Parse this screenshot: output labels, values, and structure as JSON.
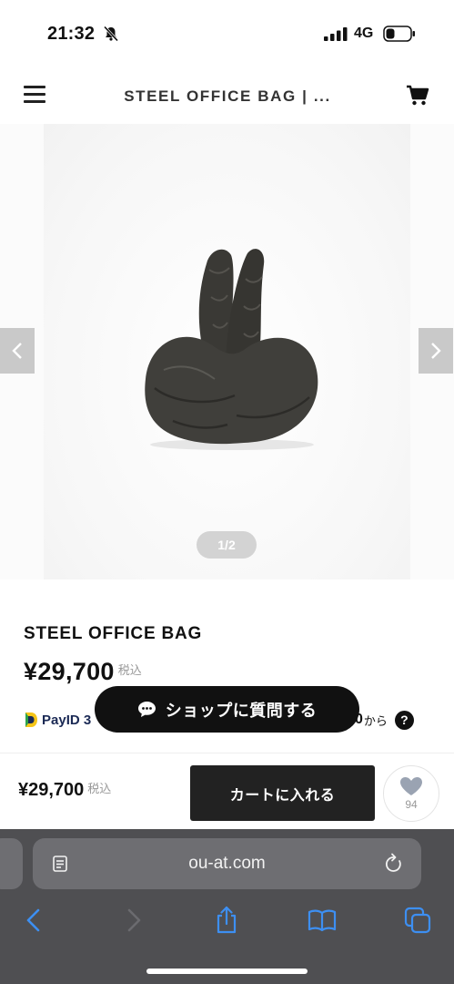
{
  "status_bar": {
    "time": "21:32",
    "network": "4G"
  },
  "header": {
    "title": "STEEL OFFICE BAG | ..."
  },
  "gallery": {
    "counter": "1/2"
  },
  "product": {
    "name": "STEEL OFFICE BAG",
    "price": "¥29,700",
    "tax_label": "税込"
  },
  "payment": {
    "brand": "PayID 3",
    "amount": "0",
    "suffix": "から",
    "help": "?"
  },
  "shop_question_button": {
    "label": "ショップに質問する"
  },
  "buy_bar": {
    "price": "¥29,700",
    "tax_label": "税込",
    "cart_button": "カートに入れる",
    "favorite_count": "94"
  },
  "browser": {
    "url": "ou-at.com"
  },
  "colors": {
    "primary_button": "#222222",
    "browser_chrome": "#4f4f52",
    "link_blue": "#3d8ff2",
    "payid_navy": "#1b2a55"
  },
  "icons": [
    "bell-slash-icon",
    "signal-icon",
    "battery-icon",
    "menu-icon",
    "cart-icon",
    "chevron-left-icon",
    "chevron-right-icon",
    "chat-bubble-icon",
    "heart-icon",
    "page-icon",
    "reload-icon",
    "back-icon",
    "forward-icon",
    "share-icon",
    "bookmarks-icon",
    "tabs-icon"
  ]
}
